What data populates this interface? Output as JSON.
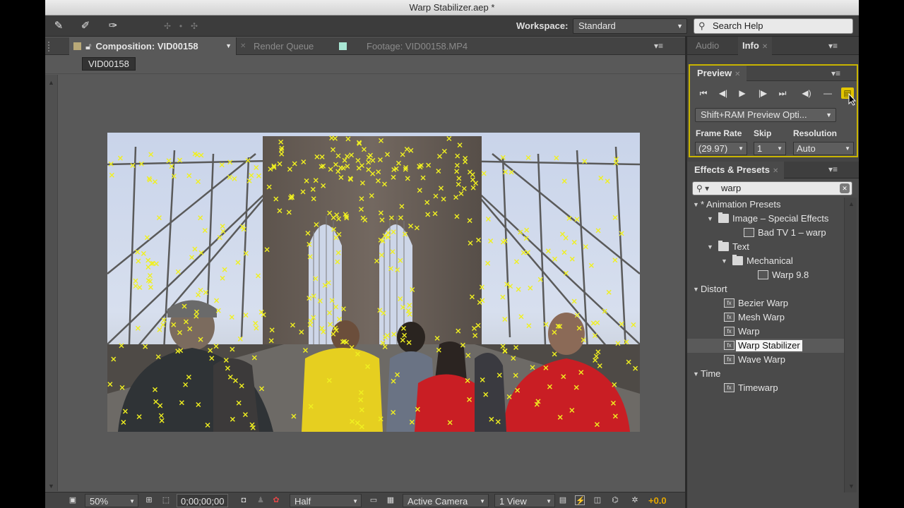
{
  "window": {
    "title": "Warp Stabilizer.aep *"
  },
  "toolbar": {
    "tools": [
      "eraser-tool",
      "puppet-pin-tool",
      "puppet-starch-tool",
      "puppet-overlap-tool"
    ],
    "workspace_label": "Workspace:",
    "workspace_value": "Standard",
    "search_help_placeholder": "Search Help"
  },
  "comp_panel": {
    "tabs": [
      {
        "label": "Composition: VID00158",
        "active": true,
        "color": "#b9a978"
      },
      {
        "label": "Render Queue",
        "active": false
      },
      {
        "label": "Footage: VID00158.MP4",
        "active": false,
        "color": "#a8e6d4"
      }
    ],
    "comp_name": "VID00158",
    "overlay_color": "#f0f020",
    "footer": {
      "zoom": "50%",
      "timecode": "0;00;00;00",
      "resolution": "Half",
      "camera": "Active Camera",
      "views": "1 View",
      "exposure": "+0.0"
    }
  },
  "right_panel": {
    "top_tabs": [
      {
        "label": "Audio",
        "active": false
      },
      {
        "label": "Info",
        "active": true
      }
    ],
    "preview": {
      "title": "Preview",
      "ram_preview_option": "Shift+RAM Preview Opti...",
      "frame_rate_label": "Frame Rate",
      "frame_rate_value": "(29.97)",
      "skip_label": "Skip",
      "skip_value": "1",
      "resolution_label": "Resolution",
      "resolution_value": "Auto"
    },
    "effects": {
      "title": "Effects & Presets",
      "search_value": "warp",
      "tree": [
        {
          "label": "* Animation Presets",
          "level": 0,
          "kind": "category",
          "open": true
        },
        {
          "label": "Image – Special Effects",
          "level": 1,
          "kind": "folder",
          "open": true
        },
        {
          "label": "Bad TV 1 – warp",
          "level": 2,
          "kind": "preset"
        },
        {
          "label": "Text",
          "level": 1,
          "kind": "folder",
          "open": true
        },
        {
          "label": "Mechanical",
          "level": 2,
          "kind": "folder",
          "open": true
        },
        {
          "label": "Warp 9.8",
          "level": 3,
          "kind": "preset"
        },
        {
          "label": "Distort",
          "level": 0,
          "kind": "category",
          "open": true
        },
        {
          "label": "Bezier Warp",
          "level": 1,
          "kind": "effect"
        },
        {
          "label": "Mesh Warp",
          "level": 1,
          "kind": "effect"
        },
        {
          "label": "Warp",
          "level": 1,
          "kind": "effect"
        },
        {
          "label": "Warp Stabilizer",
          "level": 1,
          "kind": "effect",
          "selected": true
        },
        {
          "label": "Wave Warp",
          "level": 1,
          "kind": "effect"
        },
        {
          "label": "Time",
          "level": 0,
          "kind": "category",
          "open": true
        },
        {
          "label": "Timewarp",
          "level": 1,
          "kind": "effect"
        }
      ]
    }
  }
}
